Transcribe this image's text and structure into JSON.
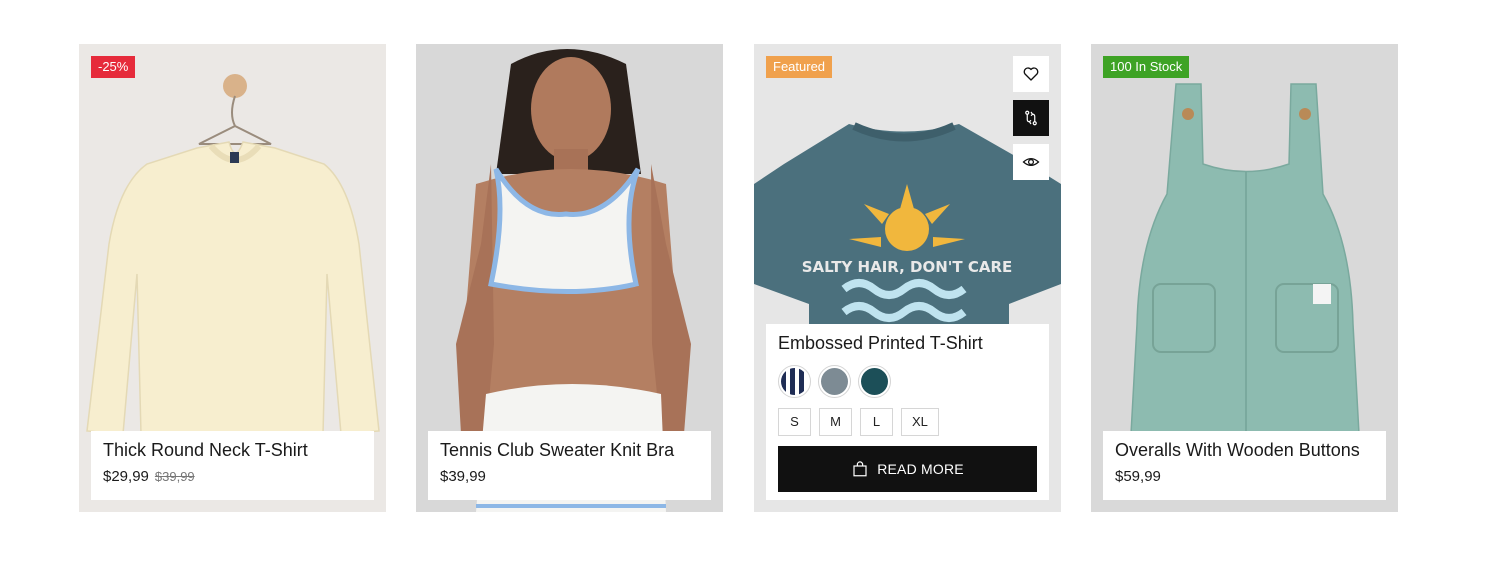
{
  "products": [
    {
      "badge": "-25%",
      "badge_color": "#e62b3b",
      "title": "Thick Round Neck T-Shirt",
      "price": "$29,99",
      "old_price": "$39,99"
    },
    {
      "title": "Tennis Club Sweater Knit Bra",
      "price": "$39,99"
    },
    {
      "badge": "Featured",
      "badge_color": "#f0a14d",
      "title": "Embossed Printed T-Shirt",
      "shirt_print": "SALTY HAIR, DON'T CARE",
      "swatches": [
        "#1f2d55",
        "#7d8b94",
        "#1c4f58"
      ],
      "sizes": [
        "S",
        "M",
        "L",
        "XL"
      ],
      "button_label": "READ MORE",
      "actions": [
        "heart-icon",
        "compare-icon",
        "eye-icon"
      ]
    },
    {
      "badge": "100 In Stock",
      "badge_color": "#3ea325",
      "title": "Overalls With Wooden Buttons",
      "price": "$59,99"
    }
  ]
}
